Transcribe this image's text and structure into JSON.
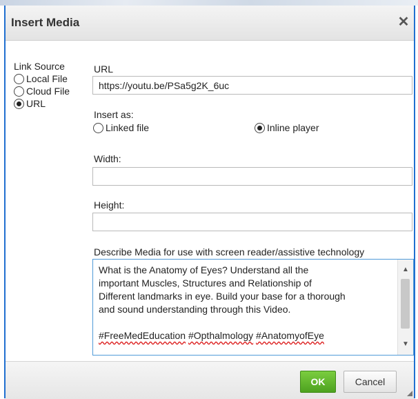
{
  "dialog": {
    "title": "Insert Media",
    "close_icon": "close-icon"
  },
  "link_source": {
    "label": "Link Source",
    "options": [
      {
        "label": "Local File",
        "selected": false
      },
      {
        "label": "Cloud File",
        "selected": false
      },
      {
        "label": "URL",
        "selected": true
      }
    ]
  },
  "url": {
    "label": "URL",
    "value": "https://youtu.be/PSa5g2K_6uc"
  },
  "insert_as": {
    "label": "Insert as:",
    "options": [
      {
        "label": "Linked file",
        "selected": false
      },
      {
        "label": "Inline player",
        "selected": true
      }
    ]
  },
  "width": {
    "label": "Width:",
    "value": ""
  },
  "height": {
    "label": "Height:",
    "value": ""
  },
  "description": {
    "label": "Describe Media for use with screen reader/assistive technology",
    "line1": "What is the Anatomy of Eyes? Understand all the",
    "line2": "important Muscles, Structures and Relationship of",
    "line3": "Different landmarks in eye. Build your base for a thorough",
    "line4": "and sound understanding through this Video.",
    "tag1": "#FreeMedEducation",
    "tag2": "#Opthalmology",
    "tag3": "#AnatomyofEye"
  },
  "buttons": {
    "ok": "OK",
    "cancel": "Cancel"
  },
  "colors": {
    "accent_border": "#1f6fd0",
    "ok_green": "#5cb42a"
  }
}
